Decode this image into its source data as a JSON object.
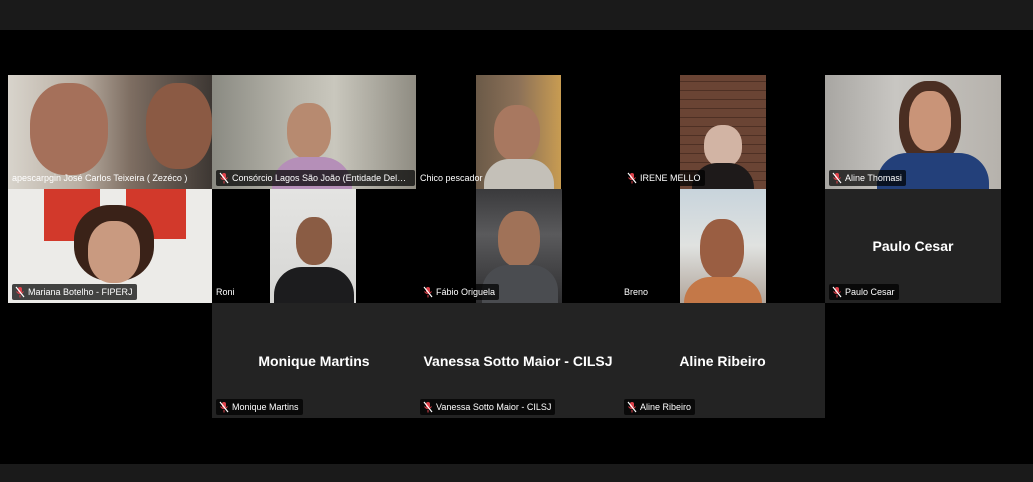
{
  "colors": {
    "muted_mic": "#e0424b",
    "active_border": "#c7d84a",
    "tile_gray": "#232323"
  },
  "participants": {
    "p1": {
      "name": "apescarpgin José Carlos Teixeira ( Zezéco )",
      "muted": false
    },
    "p2": {
      "name": "Consórcio Lagos São João (Entidade Delegatá...",
      "muted": true
    },
    "p3": {
      "name": "Chico pescador",
      "muted": false
    },
    "p4": {
      "name": "IRENE MELLO",
      "muted": true
    },
    "p5": {
      "name": "Aline Thomasi",
      "muted": true
    },
    "p6": {
      "name": "Mariana Botelho - FIPERJ",
      "muted": true
    },
    "p7": {
      "name": "Roni",
      "muted": false
    },
    "p8": {
      "name": "Fábio Origuela",
      "muted": true
    },
    "p9": {
      "name": "Breno",
      "muted": false
    },
    "p10": {
      "name": "Paulo Cesar",
      "muted": true,
      "display": "Paulo Cesar"
    },
    "p11": {
      "name": "Monique Martins",
      "muted": true,
      "display": "Monique Martins"
    },
    "p12": {
      "name": "Vanessa Sotto Maior - CILSJ",
      "muted": true,
      "display": "Vanessa Sotto Maior - CILSJ"
    },
    "p13": {
      "name": "Aline Ribeiro",
      "muted": true,
      "display": "Aline Ribeiro"
    }
  }
}
